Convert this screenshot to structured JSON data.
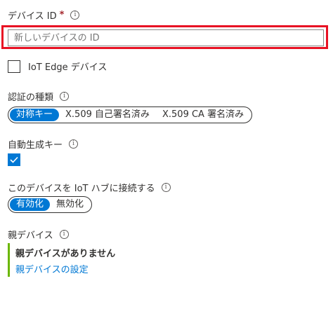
{
  "device_id": {
    "label": "デバイス ID",
    "required_mark": "*",
    "placeholder": "新しいデバイスの ID"
  },
  "iot_edge": {
    "label": "IoT Edge デバイス",
    "checked": false
  },
  "auth_type": {
    "label": "認証の種類",
    "options": [
      "対称キー",
      "X.509 自己署名済み",
      "X.509 CA 署名済み"
    ],
    "selected": "対称キー"
  },
  "auto_generate": {
    "label": "自動生成キー",
    "checked": true
  },
  "connect_hub": {
    "label": "このデバイスを IoT ハブに接続する",
    "options": [
      "有効化",
      "無効化"
    ],
    "selected": "有効化"
  },
  "parent_device": {
    "label": "親デバイス",
    "none_text": "親デバイスがありません",
    "link_text": "親デバイスの設定"
  },
  "info_glyph": "i",
  "colors": {
    "accent": "#0078d4",
    "highlight": "#e81123",
    "parent_bar": "#6bb700"
  }
}
